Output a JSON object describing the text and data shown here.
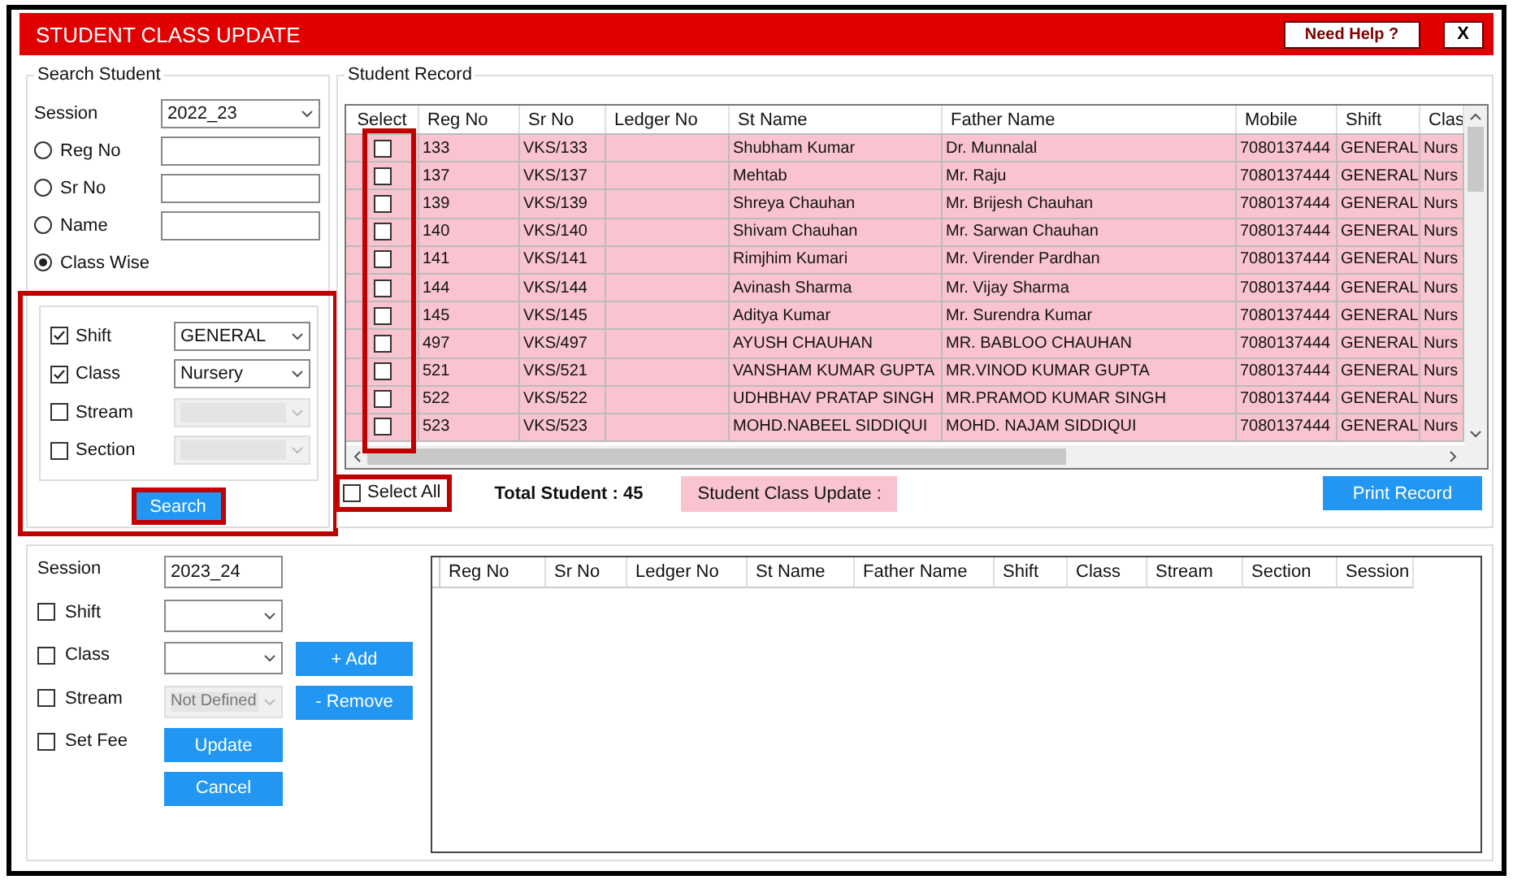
{
  "window": {
    "title": "STUDENT CLASS UPDATE",
    "buttons": [
      {
        "label": "Need Help ?",
        "kind": "help"
      },
      {
        "label": "X",
        "kind": "close"
      }
    ]
  },
  "search_student": {
    "title": "Search Student",
    "session": {
      "label": "Session",
      "value": "2022_23"
    },
    "modes": [
      {
        "label": "Reg No",
        "selected": false,
        "kind": "field"
      },
      {
        "label": "Sr No",
        "selected": false,
        "kind": "field"
      },
      {
        "label": "Name",
        "selected": false,
        "kind": "field"
      },
      {
        "label": "Class Wise",
        "selected": true,
        "kind": "plain"
      }
    ],
    "filters": [
      {
        "label": "Shift",
        "checked": true,
        "value": "GENERAL",
        "disabled": false
      },
      {
        "label": "Class",
        "checked": true,
        "value": "Nursery",
        "disabled": false
      },
      {
        "label": "Stream",
        "checked": false,
        "disabled": true
      },
      {
        "label": "Section",
        "checked": false,
        "disabled": true
      }
    ],
    "search_button": "Search"
  },
  "student_record": {
    "title": "Student Record",
    "table": {
      "columns": [
        "Select",
        "Reg No",
        "Sr No",
        "Ledger No",
        "St Name",
        "Father Name",
        "Mobile",
        "Shift",
        "Clas"
      ],
      "rows": [
        {
          "selected": false,
          "reg_no": "133",
          "sr_no": "VKS/133",
          "st_name": "Shubham Kumar",
          "father_name": "Dr. Munnalal",
          "mobile": "7080137444",
          "shift": "GENERAL",
          "class": "Nurs"
        },
        {
          "selected": false,
          "reg_no": "137",
          "sr_no": "VKS/137",
          "st_name": "Mehtab",
          "father_name": "Mr. Raju",
          "mobile": "7080137444",
          "shift": "GENERAL",
          "class": "Nurs"
        },
        {
          "selected": false,
          "reg_no": "139",
          "sr_no": "VKS/139",
          "st_name": "Shreya Chauhan",
          "father_name": "Mr. Brijesh Chauhan",
          "mobile": "7080137444",
          "shift": "GENERAL",
          "class": "Nurs"
        },
        {
          "selected": false,
          "reg_no": "140",
          "sr_no": "VKS/140",
          "st_name": "Shivam Chauhan",
          "father_name": "Mr. Sarwan Chauhan",
          "mobile": "7080137444",
          "shift": "GENERAL",
          "class": "Nurs"
        },
        {
          "selected": false,
          "reg_no": "141",
          "sr_no": "VKS/141",
          "st_name": "Rimjhim Kumari",
          "father_name": "Mr. Virender Pardhan",
          "mobile": "7080137444",
          "shift": "GENERAL",
          "class": "Nurs"
        },
        {
          "selected": false,
          "reg_no": "144",
          "sr_no": "VKS/144",
          "st_name": "Avinash Sharma",
          "father_name": "Mr. Vijay Sharma",
          "mobile": "7080137444",
          "shift": "GENERAL",
          "class": "Nurs"
        },
        {
          "selected": false,
          "reg_no": "145",
          "sr_no": "VKS/145",
          "st_name": "Aditya Kumar",
          "father_name": "Mr. Surendra Kumar",
          "mobile": "7080137444",
          "shift": "GENERAL",
          "class": "Nurs"
        },
        {
          "selected": false,
          "reg_no": "497",
          "sr_no": "VKS/497",
          "st_name": "AYUSH CHAUHAN",
          "father_name": "MR. BABLOO CHAUHAN",
          "mobile": "7080137444",
          "shift": "GENERAL",
          "class": "Nurs"
        },
        {
          "selected": false,
          "reg_no": "521",
          "sr_no": "VKS/521",
          "st_name": "VANSHAM KUMAR GUPTA",
          "father_name": "MR.VINOD KUMAR GUPTA",
          "mobile": "7080137444",
          "shift": "GENERAL",
          "class": "Nurs"
        },
        {
          "selected": false,
          "reg_no": "522",
          "sr_no": "VKS/522",
          "st_name": "UDHBHAV PRATAP SINGH",
          "father_name": "MR.PRAMOD KUMAR SINGH",
          "mobile": "7080137444",
          "shift": "GENERAL",
          "class": "Nurs"
        },
        {
          "selected": false,
          "reg_no": "523",
          "sr_no": "VKS/523",
          "st_name": "MOHD.NABEEL SIDDIQUI",
          "father_name": "MOHD. NAJAM SIDDIQUI",
          "mobile": "7080137444",
          "shift": "GENERAL",
          "class": "Nurs"
        }
      ]
    },
    "select_all": {
      "label": "Select All",
      "checked": false
    },
    "total": "Total Student : 45",
    "status": "Student Class Update :",
    "print_button": "Print Record"
  },
  "update": {
    "session": {
      "label": "Session",
      "value": "2023_24"
    },
    "options": [
      {
        "label": "Shift",
        "checked": false,
        "kind": "dropdown",
        "disabled": false
      },
      {
        "label": "Class",
        "checked": false,
        "kind": "dropdown",
        "disabled": false
      },
      {
        "label": "Stream",
        "checked": false,
        "kind": "dropdown",
        "value": "Not Defined",
        "disabled": true
      },
      {
        "label": "Set Fee",
        "checked": false,
        "kind": "plain"
      }
    ],
    "add_button": "+ Add",
    "remove_button": "- Remove",
    "update_button": "Update",
    "cancel_button": "Cancel",
    "table": {
      "columns": [
        "Reg No",
        "Sr No",
        "Ledger No",
        "St Name",
        "Father Name",
        "Shift",
        "Class",
        "Stream",
        "Section",
        "Session"
      ]
    }
  }
}
